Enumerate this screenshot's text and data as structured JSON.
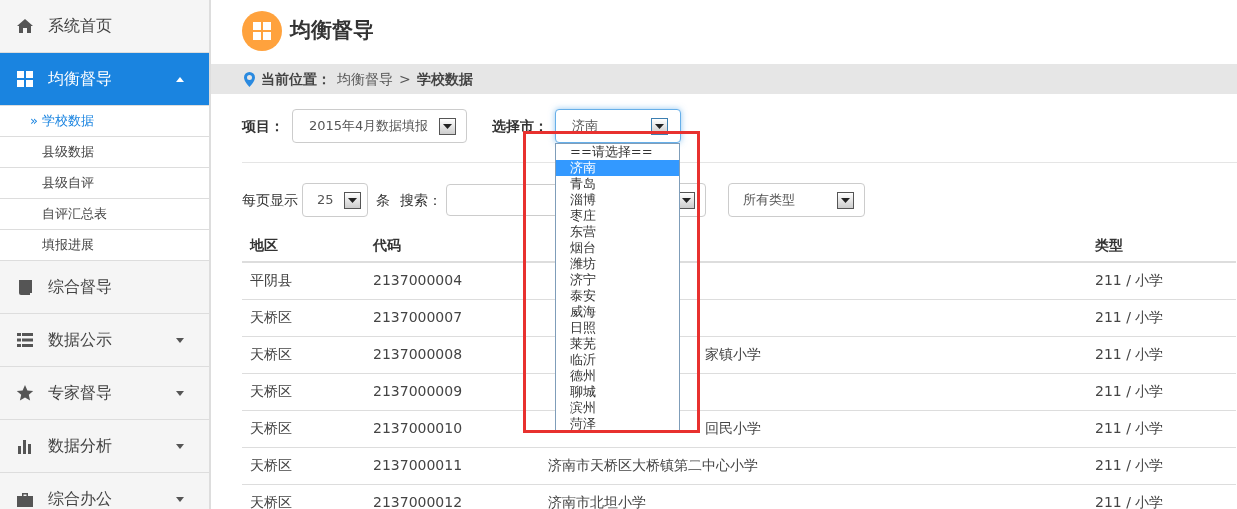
{
  "sidebar": {
    "items": [
      {
        "label": "系统首页",
        "selected": false
      },
      {
        "label": "均衡督导",
        "selected": true,
        "expanded": true,
        "children": [
          {
            "label": "» 学校数据",
            "selected": true
          },
          {
            "label": "县级数据",
            "selected": false
          },
          {
            "label": "县级自评",
            "selected": false
          },
          {
            "label": "自评汇总表",
            "selected": false
          },
          {
            "label": "填报进展",
            "selected": false
          }
        ]
      },
      {
        "label": "综合督导",
        "selected": false
      },
      {
        "label": "数据公示",
        "selected": false,
        "expanded": false
      },
      {
        "label": "专家督导",
        "selected": false,
        "expanded": false
      },
      {
        "label": "数据分析",
        "selected": false,
        "expanded": false
      },
      {
        "label": "综合办公",
        "selected": false,
        "expanded": false
      }
    ]
  },
  "page_title": "均衡督导",
  "breadcrumb": {
    "label": "当前位置：",
    "path": "均衡督导",
    "separator": ">",
    "current": "学校数据"
  },
  "filters": {
    "project_label": "项目：",
    "project_value": "2015年4月数据填报",
    "city_label": "选择市：",
    "city_value": "济南",
    "city_options": [
      {
        "label": "==请选择==",
        "selected": false
      },
      {
        "label": "济南",
        "selected": true
      },
      {
        "label": "青岛",
        "selected": false
      },
      {
        "label": "淄博",
        "selected": false
      },
      {
        "label": "枣庄",
        "selected": false
      },
      {
        "label": "东营",
        "selected": false
      },
      {
        "label": "烟台",
        "selected": false
      },
      {
        "label": "潍坊",
        "selected": false
      },
      {
        "label": "济宁",
        "selected": false
      },
      {
        "label": "泰安",
        "selected": false
      },
      {
        "label": "威海",
        "selected": false
      },
      {
        "label": "日照",
        "selected": false
      },
      {
        "label": "莱芜",
        "selected": false
      },
      {
        "label": "临沂",
        "selected": false
      },
      {
        "label": "德州",
        "selected": false
      },
      {
        "label": "聊城",
        "selected": false
      },
      {
        "label": "滨州",
        "selected": false
      },
      {
        "label": "菏泽",
        "selected": false
      }
    ]
  },
  "table_controls": {
    "page_size_label": "每页显示",
    "page_size": "25",
    "page_size_unit": "条",
    "search_label": "搜索：",
    "type_filter": "所有类型"
  },
  "annotation": {
    "shown": true
  },
  "table": {
    "columns": [
      "地区",
      "代码",
      "",
      "类型"
    ],
    "rows": [
      {
        "region": "平阴县",
        "code": "2137000004",
        "type": "211 / 小学"
      },
      {
        "region": "天桥区",
        "code": "2137000007",
        "type": "211 / 小学"
      },
      {
        "region": "天桥区",
        "code": "2137000008",
        "name_right": "家镇小学",
        "type": "211 / 小学"
      },
      {
        "region": "天桥区",
        "code": "2137000009",
        "type": "211 / 小学"
      },
      {
        "region": "天桥区",
        "code": "2137000010",
        "name_right": "回民小学",
        "type": "211 / 小学"
      },
      {
        "region": "天桥区",
        "code": "2137000011",
        "name_left": "济南市天桥区大桥镇第二中心小学",
        "type": "211 / 小学"
      },
      {
        "region": "天桥区",
        "code": "2137000012",
        "name_left": "济南市北坦小学",
        "type": "211 / 小学"
      }
    ]
  }
}
